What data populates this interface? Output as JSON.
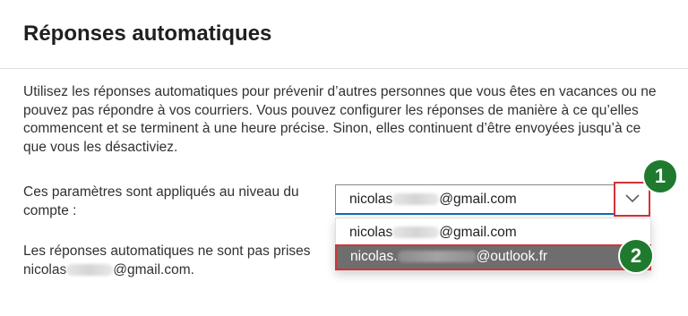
{
  "header": {
    "title": "Réponses automatiques"
  },
  "description": "Utilisez les réponses automatiques pour prévenir d’autres personnes que vous êtes en vacances ou ne pouvez pas répondre à vos courriers. Vous pouvez configurer les réponses de manière à ce qu’elles commencent et se terminent à une heure précise. Sinon, elles continuent d’être envoyées jusqu’à ce que vous les désactiviez.",
  "scope": {
    "label": "Ces paramètres sont appliqués au niveau du compte :",
    "selected": {
      "prefix": "nicolas",
      "suffix": "@gmail.com"
    },
    "options": [
      {
        "prefix": "nicolas",
        "suffix": "@gmail.com"
      },
      {
        "prefix": "nicolas.",
        "suffix": "@outlook.fr"
      }
    ]
  },
  "note": {
    "line1": "Les réponses automatiques ne sont pas prises",
    "prefix": "nicolas",
    "suffix": "@gmail.com."
  },
  "annotations": {
    "step1": "1",
    "step2": "2"
  },
  "colors": {
    "highlight_border": "#d13438",
    "badge": "#1f7a2e",
    "selected_option_bg": "#6e6e6e"
  },
  "icons": {
    "dropdown": "chevron-down-icon"
  }
}
